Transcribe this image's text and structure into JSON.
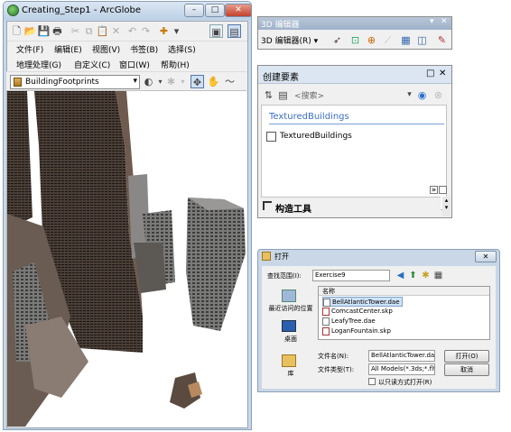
{
  "arcglobe": {
    "title": "Creating_Step1 - ArcGlobe",
    "window_buttons": [
      "–",
      "□",
      "✕"
    ],
    "menus_row1": [
      "文件(F)",
      "编辑(E)",
      "视图(V)",
      "书签(B)",
      "选择(S)"
    ],
    "menus_row2": [
      "地理处理(G)",
      "自定义(C)",
      "窗口(W)",
      "帮助(H)"
    ],
    "layer_combo": "BuildingFootprints"
  },
  "editor3d": {
    "title": "3D 编辑器",
    "menu_label": "3D 编辑器(R) ▾"
  },
  "create_features": {
    "title": "创建要素",
    "search_placeholder": "<搜索>",
    "group_title": "TexturedBuildings",
    "item_label": "TexturedBuildings",
    "footer_label": "构造工具"
  },
  "open_dialog": {
    "title": "打开",
    "lookin_label": "查找范围(I):",
    "lookin_value": "Exercise9",
    "column_name": "名称",
    "places": [
      "最近访问的位置",
      "桌面",
      "库"
    ],
    "files": [
      "BellAtlanticTower.dae",
      "ComcastCenter.skp",
      "LeafyTree.dae",
      "LoganFountain.skp"
    ],
    "selected_index": 0,
    "filename_label": "文件名(N):",
    "filename_value": "BellAtlanticTower.da▾",
    "filetype_label": "文件类型(T):",
    "filetype_value": "All Models(*.3ds;*.flt;*",
    "open_button": "打开(O)",
    "cancel_button": "取消",
    "readonly_label": "以只读方式打开(R)"
  },
  "colors": {
    "title_bar_blue": "#bcd0e6",
    "selection_blue": "#cfe3f8",
    "group_title_blue": "#3a6fc4"
  }
}
